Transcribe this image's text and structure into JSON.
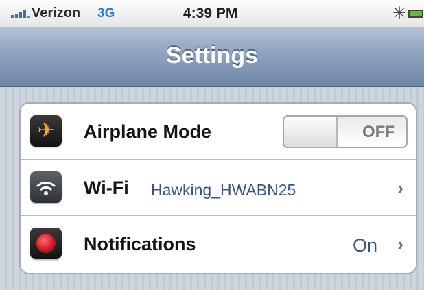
{
  "status_bar": {
    "carrier": "Verizon",
    "network": "3G",
    "time": "4:39 PM",
    "bluetooth_icon": "bluetooth-icon",
    "battery_icon": "battery-icon"
  },
  "nav_bar": {
    "title": "Settings"
  },
  "settings": {
    "rows": [
      {
        "label": "Airplane Mode",
        "icon": "airplane-icon",
        "toggle_state": "OFF"
      },
      {
        "label": "Wi-Fi",
        "icon": "wifi-icon",
        "value": "Hawking_HWABN25"
      },
      {
        "label": "Notifications",
        "icon": "notifications-icon",
        "value": "On"
      }
    ]
  },
  "colors": {
    "nav_bar": "#8ea3bf",
    "value_text": "#385487",
    "network_text": "#2f7fd0",
    "battery": "#59c034"
  }
}
